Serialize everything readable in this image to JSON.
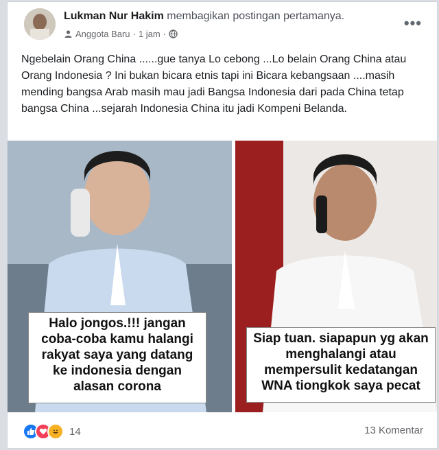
{
  "post": {
    "author": "Lukman Nur Hakim",
    "action": "membagikan postingan pertamanya.",
    "badge": "Anggota Baru",
    "separator": "·",
    "time": "1 jam",
    "separator2": "·",
    "privacy_icon": "globe-icon",
    "more_label": "•••",
    "text": "Ngebelain Orang China ......gue tanya Lo cebong ...Lo belain Orang China atau Orang Indonesia ? Ini bukan bicara etnis tapi ini Bicara kebangsaan ....masih mending bangsa Arab masih mau jadi Bangsa Indonesia dari pada China tetap bangsa China ...sejarah Indonesia China itu jadi Kompeni Belanda."
  },
  "image": {
    "left_caption": "Halo jongos.!!! jangan coba-coba kamu halangi rakyat saya yang datang ke indonesia dengan alasan corona",
    "right_caption": "Siap tuan. siapapun yg akan menghalangi atau mempersulit kedatangan WNA tiongkok saya pecat"
  },
  "footer": {
    "reaction_count": "14",
    "comments": "13 Komentar"
  },
  "colors": {
    "like": "#1877f2",
    "love": "#f33e58",
    "haha": "#f7b125"
  }
}
